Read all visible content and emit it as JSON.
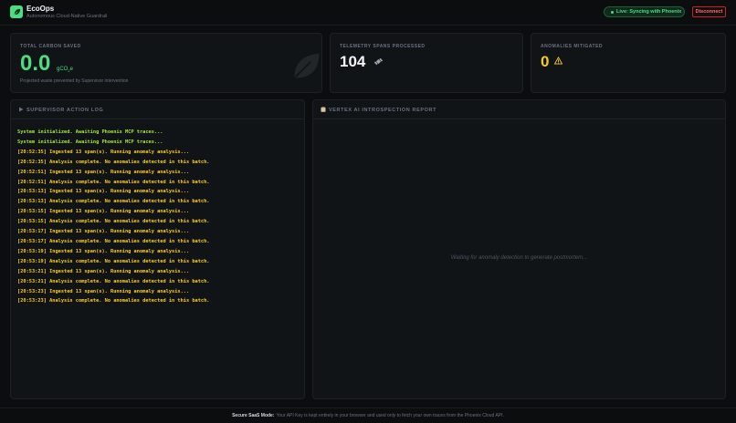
{
  "header": {
    "title": "EcoOps",
    "subtitle": "Autonomous Cloud-Native Guardrail",
    "live_status": "Live: Syncing with Phoenix",
    "disconnect_label": "Disconnect",
    "logo_icon": "leaf-icon"
  },
  "stats": {
    "carbon": {
      "label": "Total Carbon Saved",
      "value": "0.0",
      "unit": "gCO",
      "unit_sub": "2",
      "unit_suffix": "e",
      "note": "Projected waste prevented by Supervisor intervention",
      "icon": "leaf-icon"
    },
    "spans": {
      "label": "Telemetry Spans Processed",
      "value": "104",
      "icon": "satellite-icon"
    },
    "anomalies": {
      "label": "Anomalies Mitigated",
      "value": "0",
      "icon": "warning-icon"
    }
  },
  "supervisor_log": {
    "title": "Supervisor Action Log",
    "icon": "play-icon",
    "entries": [
      {
        "type": "system",
        "text": "System initialized. Awaiting Phoenix MCP traces..."
      },
      {
        "type": "system",
        "text": "System initialized. Awaiting Phoenix MCP traces..."
      },
      {
        "type": "ingest",
        "text": "[20:52:35] Ingested 13 span(s). Running anomaly analysis..."
      },
      {
        "type": "analysis",
        "text": "[20:52:35] Analysis complete. No anomalies detected in this batch."
      },
      {
        "type": "ingest",
        "text": "[20:52:51] Ingested 13 span(s). Running anomaly analysis..."
      },
      {
        "type": "analysis",
        "text": "[20:52:51] Analysis complete. No anomalies detected in this batch."
      },
      {
        "type": "ingest",
        "text": "[20:53:13] Ingested 13 span(s). Running anomaly analysis..."
      },
      {
        "type": "analysis",
        "text": "[20:53:13] Analysis complete. No anomalies detected in this batch."
      },
      {
        "type": "ingest",
        "text": "[20:53:15] Ingested 13 span(s). Running anomaly analysis..."
      },
      {
        "type": "analysis",
        "text": "[20:53:15] Analysis complete. No anomalies detected in this batch."
      },
      {
        "type": "ingest",
        "text": "[20:53:17] Ingested 13 span(s). Running anomaly analysis..."
      },
      {
        "type": "analysis",
        "text": "[20:53:17] Analysis complete. No anomalies detected in this batch."
      },
      {
        "type": "ingest",
        "text": "[20:53:19] Ingested 13 span(s). Running anomaly analysis..."
      },
      {
        "type": "analysis",
        "text": "[20:53:19] Analysis complete. No anomalies detected in this batch."
      },
      {
        "type": "ingest",
        "text": "[20:53:21] Ingested 13 span(s). Running anomaly analysis..."
      },
      {
        "type": "analysis",
        "text": "[20:53:21] Analysis complete. No anomalies detected in this batch."
      },
      {
        "type": "ingest",
        "text": "[20:53:23] Ingested 13 span(s). Running anomaly analysis..."
      },
      {
        "type": "analysis",
        "text": "[20:53:23] Analysis complete. No anomalies detected in this batch."
      }
    ]
  },
  "report": {
    "title": "Vertex AI Introspection Report",
    "icon": "clipboard-icon",
    "placeholder": "Waiting for anomaly detection to generate postmortem..."
  },
  "footer": {
    "label": "Secure SaaS Mode:",
    "text": "Your API Key is kept entirely in your browser and used only to fetch your own traces from the Phoenix Cloud API."
  },
  "colors": {
    "accent_green": "#4ade80",
    "warning_yellow": "#facc15",
    "danger_red": "#f87171",
    "background": "#0b0d0f",
    "card": "#111417"
  }
}
